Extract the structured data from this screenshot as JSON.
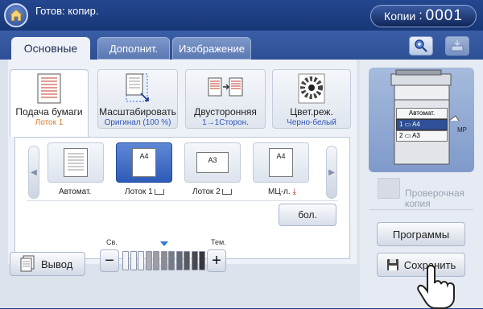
{
  "header": {
    "status": "Готов: копир.",
    "copies_label": "Копии",
    "copies_sep": ":",
    "copies_value": "0001"
  },
  "tabs": [
    {
      "label": "Основные",
      "active": true
    },
    {
      "label": "Дополнит.",
      "active": false
    },
    {
      "label": "Изображение",
      "active": false
    }
  ],
  "functions": [
    {
      "title": "Подача бумаги",
      "value": "Лоток 1",
      "selected": true
    },
    {
      "title": "Масштабировать",
      "value": "Оригинал (100 %)"
    },
    {
      "title": "Двусторонняя",
      "value": "1→1Сторон."
    },
    {
      "title": "Цвет.реж.",
      "value": "Черно-белый"
    }
  ],
  "trays": [
    {
      "label": "Автомат.",
      "size": ""
    },
    {
      "label": "Лоток 1",
      "size": "A4",
      "selected": true
    },
    {
      "label": "Лоток 2",
      "size": "A3"
    },
    {
      "label": "МЦ-л.",
      "size": "A4"
    }
  ],
  "more_label": "бол.",
  "output_label": "Вывод",
  "density": {
    "light_label": "Св.",
    "dark_label": "Тем.",
    "minus": "−",
    "plus": "+",
    "level": 6,
    "steps": 11
  },
  "machine": {
    "rows": [
      {
        "text": "Автомат.",
        "selected": false
      },
      {
        "text": "1 ▭ A4",
        "selected": true
      },
      {
        "text": "2 ▭ A3",
        "selected": false
      }
    ],
    "mp": "MP"
  },
  "proof_copy": {
    "line1": "Проверочная",
    "line2": "копия"
  },
  "programs_label": "Программы",
  "save_label": "Сохранить",
  "colors": {
    "header": "#1e3e86",
    "accent": "#2e5bb8",
    "orange": "#e07a1f",
    "blue_text": "#2f55b8"
  }
}
